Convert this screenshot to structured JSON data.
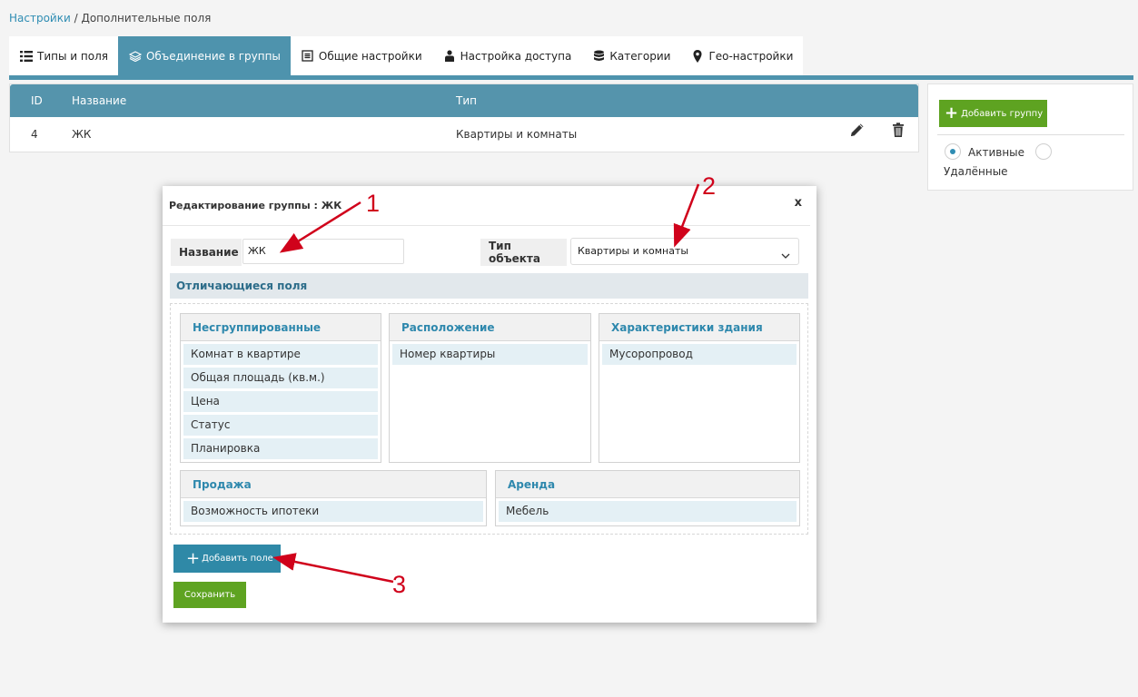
{
  "breadcrumb": {
    "root": "Настройки",
    "separator": " / ",
    "current": "Дополнительные поля"
  },
  "tabs": [
    {
      "label": "Типы и поля",
      "icon": "list-icon"
    },
    {
      "label": "Объединение в группы",
      "icon": "layers-icon",
      "active": true
    },
    {
      "label": "Общие настройки",
      "icon": "document-icon"
    },
    {
      "label": "Настройка доступа",
      "icon": "user-icon"
    },
    {
      "label": "Категории",
      "icon": "database-icon"
    },
    {
      "label": "Гео-настройки",
      "icon": "map-pin-icon"
    }
  ],
  "table": {
    "headers": {
      "id": "ID",
      "name": "Название",
      "type": "Тип"
    },
    "rows": [
      {
        "id": "4",
        "name": "ЖК",
        "type": "Квартиры и комнаты"
      }
    ]
  },
  "right_panel": {
    "add_group_label": "Добавить группу",
    "radio_active": "Активные",
    "radio_deleted": "Удалённые"
  },
  "modal": {
    "title": "Редактирование группы : ЖК",
    "close": "x",
    "name_label": "Название",
    "name_value": "ЖК",
    "type_label": "Тип объекта",
    "type_value": "Квартиры и комнаты",
    "section_title": "Отличающиеся поля",
    "groups": [
      {
        "title": "Несгруппированные",
        "items": [
          "Комнат в квартире",
          "Общая площадь (кв.м.)",
          "Цена",
          "Статус",
          "Планировка"
        ]
      },
      {
        "title": "Расположение",
        "items": [
          "Номер квартиры"
        ]
      },
      {
        "title": "Характеристики здания",
        "items": [
          "Мусоропровод"
        ]
      },
      {
        "title": "Продажа",
        "items": [
          "Возможность ипотеки"
        ]
      },
      {
        "title": "Аренда",
        "items": [
          "Мебель"
        ]
      }
    ],
    "add_field_label": "Добавить поле",
    "save_label": "Сохранить"
  },
  "annotations": {
    "n1": "1",
    "n2": "2",
    "n3": "3",
    "color": "#d0021b"
  },
  "colors": {
    "accent": "#4e93ad",
    "green": "#5ea321",
    "link": "#2f8db3"
  }
}
